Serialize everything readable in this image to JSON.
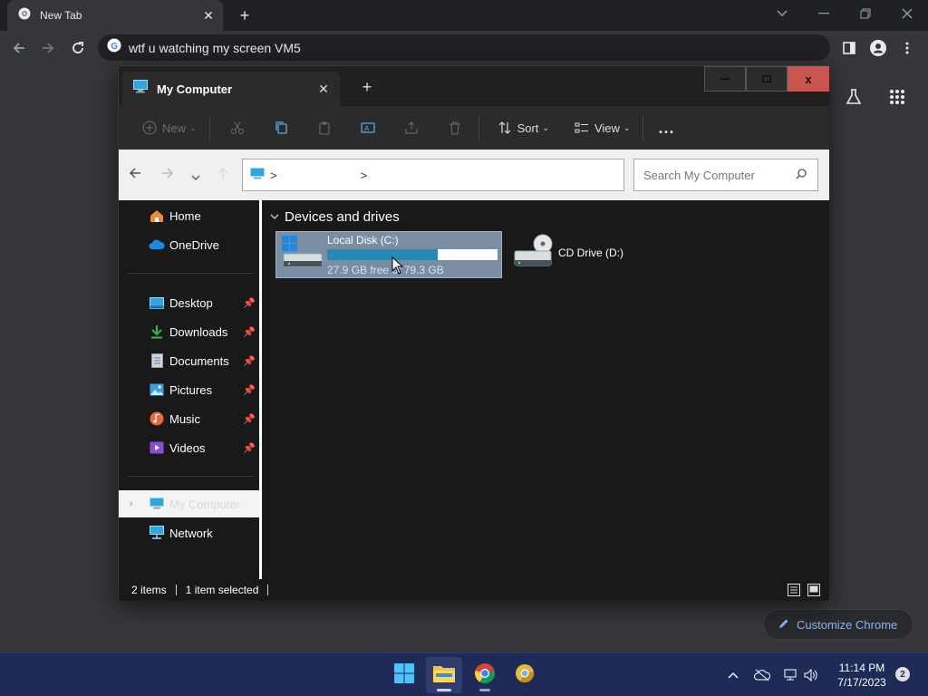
{
  "browser": {
    "tab_title": "New Tab",
    "omnibox_text": "wtf u watching my screen VM5",
    "customize_label": "Customize Chrome"
  },
  "explorer": {
    "tab_title": "My Computer",
    "window_close": "x",
    "commands": {
      "new": "New",
      "sort": "Sort",
      "view": "View",
      "more": "..."
    },
    "address": {
      "sep1": ">",
      "sep2": ">"
    },
    "search_placeholder": "Search My Computer",
    "nav": {
      "home": "Home",
      "onedrive": "OneDrive",
      "desktop": "Desktop",
      "downloads": "Downloads",
      "documents": "Documents",
      "pictures": "Pictures",
      "music": "Music",
      "videos": "Videos",
      "my_computer": "My Computer",
      "network": "Network"
    },
    "group_header": "Devices and drives",
    "drive_c": {
      "name": "Local Disk (C:)",
      "free_text": "27.9 GB free of 79.3 GB",
      "used_fraction": 0.65
    },
    "drive_d": {
      "name": "CD Drive (D:)"
    },
    "status": {
      "items": "2 items",
      "selected": "1 item selected"
    }
  },
  "taskbar": {
    "time": "11:14 PM",
    "date": "7/17/2023",
    "notifications": "2"
  },
  "colors": {
    "accent": "#268bb2",
    "selection": "#7a8ea3",
    "taskbar": "#1f2b57",
    "close_red": "#c9554f"
  }
}
